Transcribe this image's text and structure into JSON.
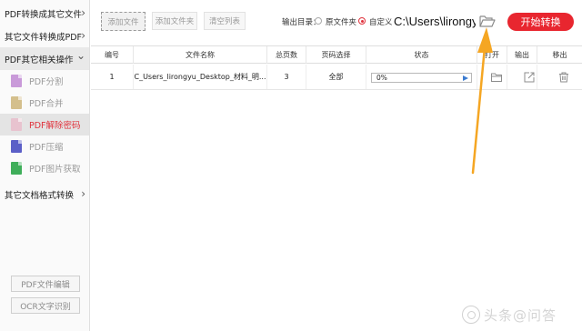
{
  "sidebar": {
    "categories": [
      {
        "label": "PDF转换成其它文件",
        "chevron": "›"
      },
      {
        "label": "其它文件转换成PDF",
        "chevron": "›"
      },
      {
        "label": "PDF其它相关操作",
        "chevron": "⌄"
      },
      {
        "label": "其它文档格式转换",
        "chevron": "›"
      }
    ],
    "items": [
      {
        "label": "PDF分割",
        "icon": "pdf-split-icon",
        "color": "#c99ad9"
      },
      {
        "label": "PDF合并",
        "icon": "pdf-merge-icon",
        "color": "#c9b27a"
      },
      {
        "label": "PDF解除密码",
        "icon": "pdf-unlock-icon",
        "color": "#e36b8f"
      },
      {
        "label": "PDF压缩",
        "icon": "pdf-compress-icon",
        "color": "#5b5fc7"
      },
      {
        "label": "PDF图片获取",
        "icon": "pdf-image-icon",
        "color": "#3fae5a"
      }
    ],
    "bottom_buttons": [
      "PDF文件编辑",
      "OCR文字识别"
    ]
  },
  "toolbar": {
    "add_file": "添加文件",
    "add_folder": "添加文件夹",
    "clear_list": "清空列表",
    "output_dir_label": "输出目录：",
    "option_source": "原文件夹",
    "option_custom": "自定义",
    "output_path": "C:\\Users\\lirongyu",
    "start": "开始转换"
  },
  "table": {
    "headers": [
      "编号",
      "文件名称",
      "总页数",
      "页码选择",
      "状态",
      "打开",
      "输出",
      "移出"
    ],
    "rows": [
      {
        "index": "1",
        "filename": "C_Users_lirongyu_Desktop_材料_明...",
        "pages": "3",
        "page_select": "全部",
        "progress": "0%",
        "progress_value": 0
      }
    ]
  },
  "watermark": "头条@问答",
  "colors": {
    "accent": "#e8262f",
    "arrow": "#f5a623",
    "active_text": "#e0323c"
  }
}
